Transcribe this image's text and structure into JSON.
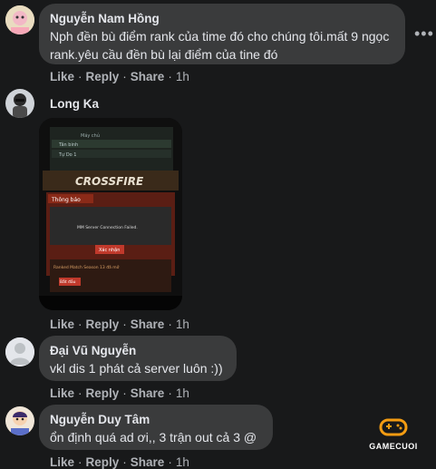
{
  "comments": [
    {
      "author": "Nguyễn Nam Hồng",
      "text": "Nph đền bù điểm rank của time đó cho chúng tôi.mất 9 ngọc rank.yêu cầu đền bù lại điểm của tine đó",
      "time": "1h"
    },
    {
      "author": "Long Ka",
      "time": "1h",
      "photo": {
        "brand": "CROSSFIRE",
        "dialog_title": "Thông báo",
        "dialog_message": "MM Server Connection Failed.",
        "ok_button": "Xác nhận",
        "footer_text": "Ranked Match Season 13 đã mở",
        "rows": [
          "Máy chủ",
          "Tân binh",
          "Tự Do 1"
        ],
        "side_button": "Bắt đầu"
      }
    },
    {
      "author": "Đại Vũ Nguyễn",
      "text": "vkl dis 1 phát cả server luôn :))",
      "time": "1h"
    },
    {
      "author": "Nguyễn Duy Tâm",
      "text": "ổn định quá ad ơi,, 3 trận out cả 3 @",
      "time": "1h"
    }
  ],
  "actions": {
    "like": "Like",
    "reply": "Reply",
    "share": "Share",
    "separator": "·"
  },
  "more_icon": "more-horizontal-icon",
  "watermark": {
    "text": "GAMECUOI",
    "icon": "gamepad-icon",
    "color": "#f39c12"
  },
  "colors": {
    "background": "#18191a",
    "bubble": "#3a3b3c",
    "text": "#e4e6eb",
    "secondary": "#b0b3b8"
  }
}
